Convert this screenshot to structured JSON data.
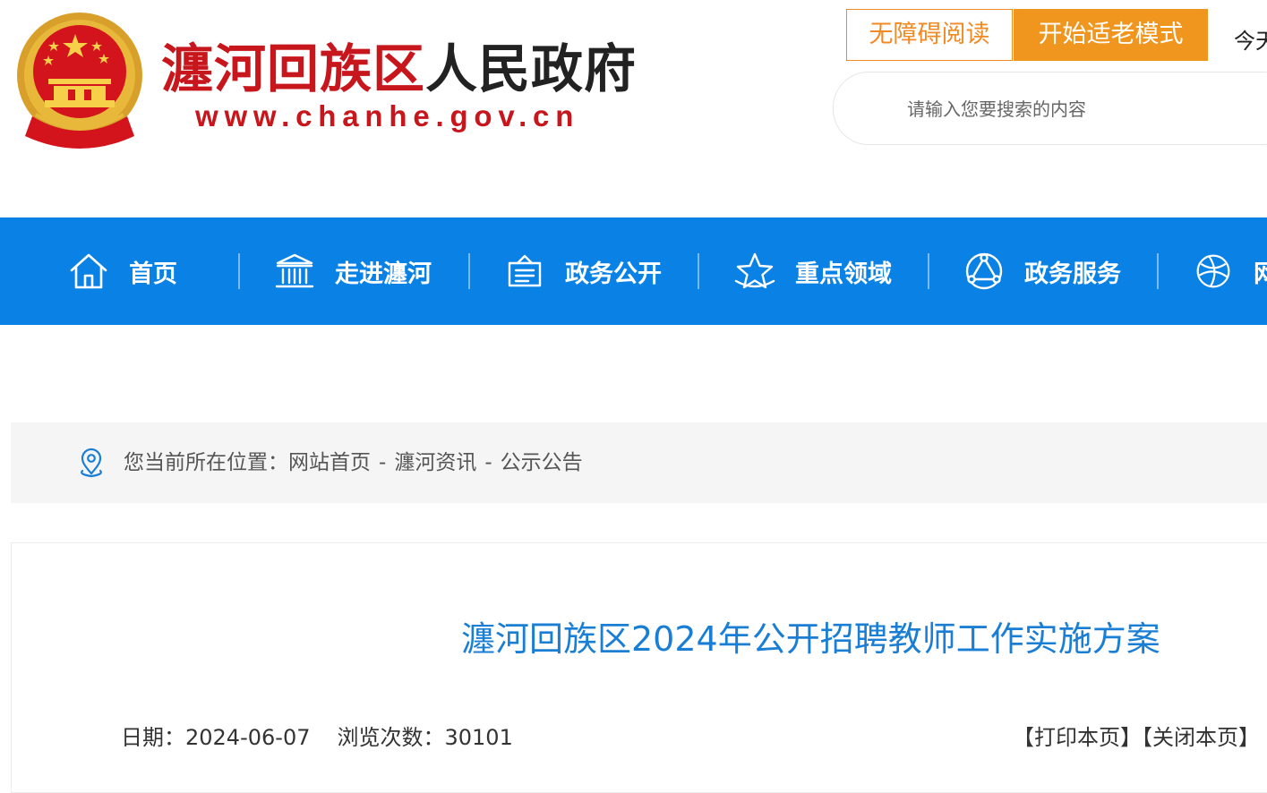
{
  "header": {
    "site_name_red": "瀍河回族区",
    "site_name_dark": "人民政府",
    "site_url": "www.chanhe.gov.cn",
    "accessible_reading_label": "无障碍阅读",
    "elder_mode_label": "开始适老模式",
    "today_text": "今天",
    "search": {
      "placeholder": "请输入您要搜索的内容"
    }
  },
  "nav": {
    "items": [
      {
        "label": "首页",
        "icon": "home-icon"
      },
      {
        "label": "走进瀍河",
        "icon": "building-icon"
      },
      {
        "label": "政务公开",
        "icon": "document-icon"
      },
      {
        "label": "重点领域",
        "icon": "star-icon"
      },
      {
        "label": "政务服务",
        "icon": "triangle-nodes-icon"
      },
      {
        "label": "网",
        "icon": "globe-icon"
      }
    ]
  },
  "breadcrumb": {
    "prefix": "您当前所在位置：",
    "items": [
      "网站首页",
      "瀍河资讯",
      "公示公告"
    ],
    "separator": "-"
  },
  "article": {
    "title": "瀍河回族区2024年公开招聘教师工作实施方案",
    "date_label": "日期：",
    "date": "2024-06-07",
    "views_label": "浏览次数：",
    "views": "30101",
    "print_label": "【打印本页】",
    "close_label": "【关闭本页】"
  },
  "colors": {
    "brand_red": "#c8161d",
    "nav_blue": "#0a82e5",
    "accent_orange": "#f0961e",
    "title_blue": "#1a7fd4"
  }
}
